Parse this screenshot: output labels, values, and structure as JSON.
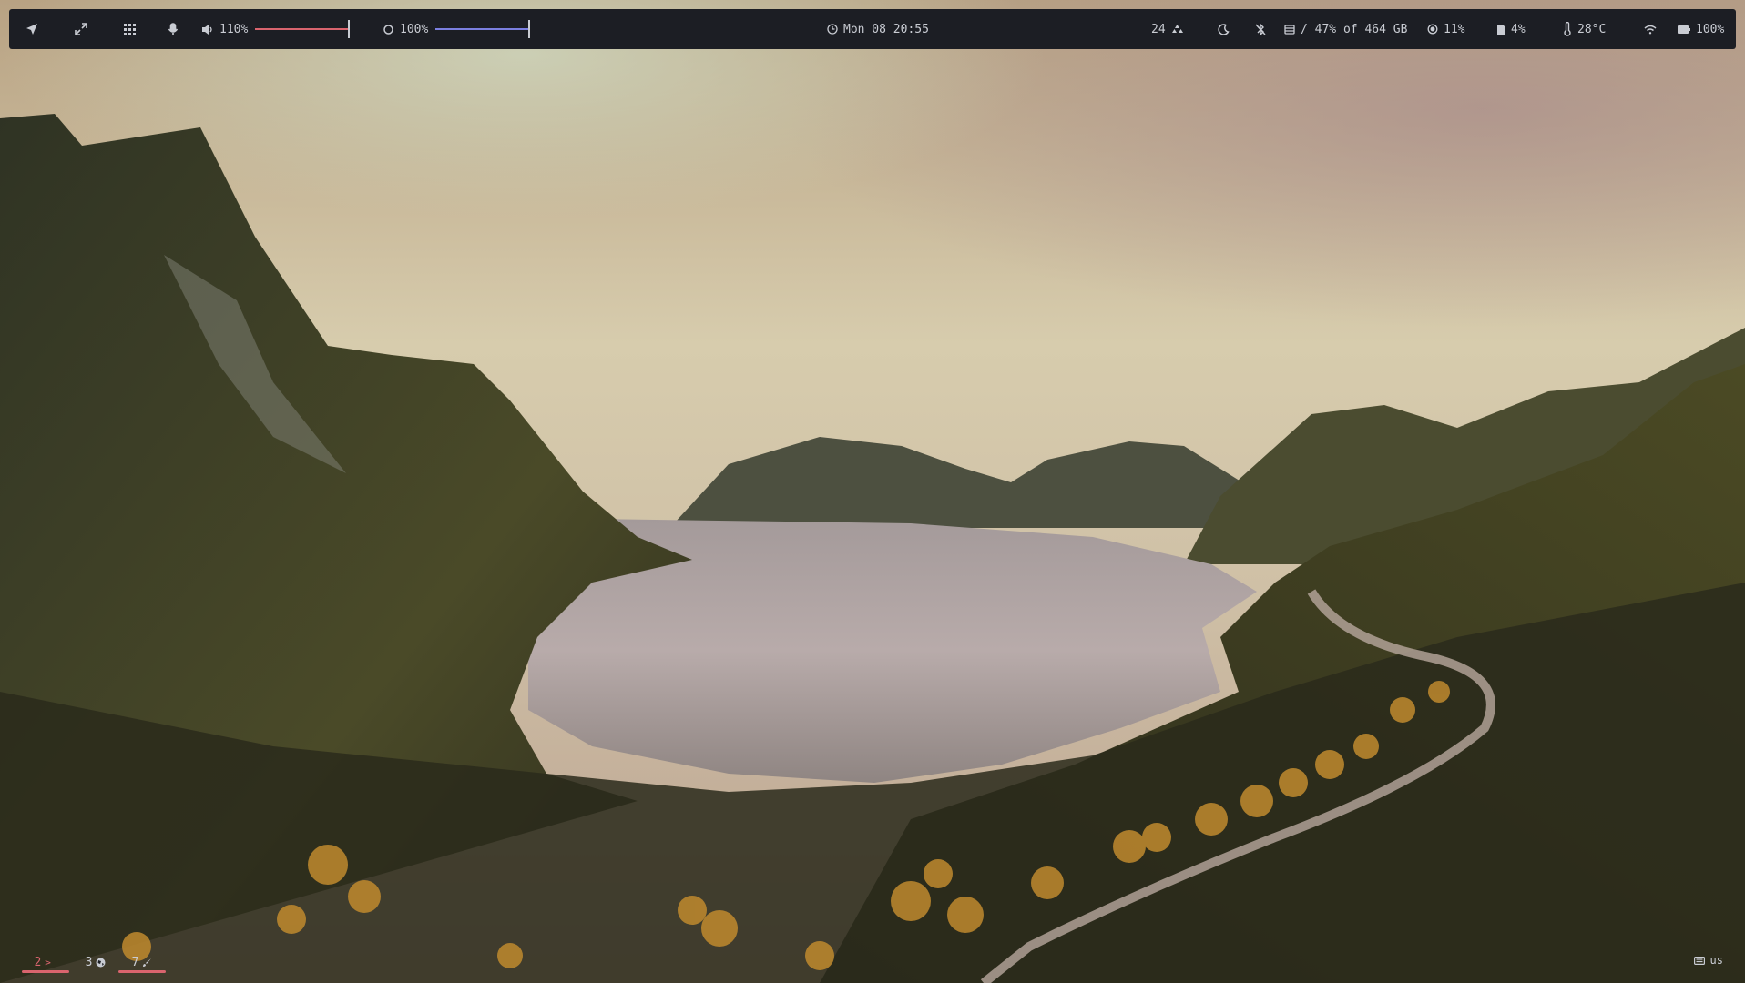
{
  "topbar": {
    "launcher_icon": "rocket-icon",
    "fullscreen_icon": "expand-icon",
    "apps_icon": "grid-icon",
    "mic_icon": "microphone-icon",
    "volume": {
      "icon": "speaker-icon",
      "label": "110%",
      "level": 1.1,
      "color": "#d9646e"
    },
    "brightness": {
      "icon": "sun-icon",
      "label": "100%",
      "level": 1.0,
      "color": "#7b7fe0"
    },
    "clock": {
      "icon": "clock-icon",
      "text": "Mon 08 20:55"
    },
    "updates": {
      "count": "24",
      "icon": "recycle-icon"
    },
    "night_mode_icon": "moon-icon",
    "bluetooth_icon": "bluetooth-off-icon",
    "disk": {
      "icon": "disk-icon",
      "text": "/ 47% of 464 GB"
    },
    "cpu": {
      "icon": "cpu-icon",
      "text": "11%"
    },
    "memory": {
      "icon": "memory-icon",
      "text": "4%"
    },
    "temperature": {
      "icon": "thermometer-icon",
      "text": "28°C"
    },
    "wifi_icon": "wifi-icon",
    "battery": {
      "icon": "battery-icon",
      "text": "100%"
    }
  },
  "workspaces": [
    {
      "number": "2",
      "glyph": ">_",
      "icon": "terminal-icon",
      "active": true,
      "underline": true,
      "color": "#d9646e"
    },
    {
      "number": "3",
      "glyph": "",
      "icon": "globe-icon",
      "active": false,
      "underline": false
    },
    {
      "number": "7",
      "glyph": "",
      "icon": "brush-icon",
      "active": false,
      "underline": true
    }
  ],
  "keyboard_layout": {
    "icon": "keyboard-icon",
    "text": "us"
  }
}
